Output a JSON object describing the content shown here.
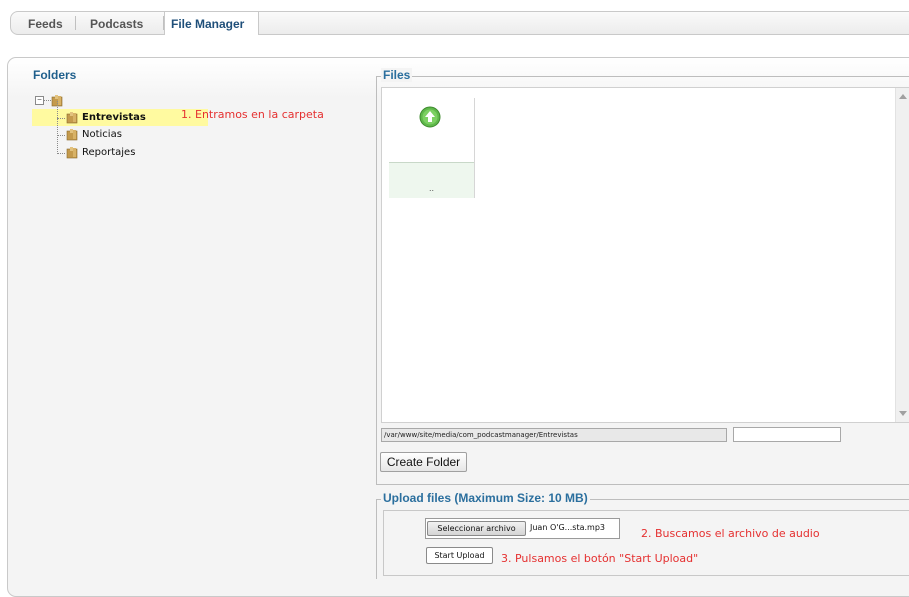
{
  "tabs": [
    {
      "label": "Feeds",
      "active": false
    },
    {
      "label": "Podcasts",
      "active": false
    },
    {
      "label": "File Manager",
      "active": true
    }
  ],
  "folders": {
    "title": "Folders",
    "items": [
      {
        "label": "Entrevistas",
        "selected": true
      },
      {
        "label": "Noticias",
        "selected": false
      },
      {
        "label": "Reportajes",
        "selected": false
      }
    ],
    "annotation": "1. Entramos en la carpeta"
  },
  "files": {
    "legend": "Files",
    "parent_item_label": "..",
    "path": "/var/www/site/media/com_podcastmanager/Entrevistas",
    "new_folder_name": "",
    "create_folder_label": "Create Folder"
  },
  "upload": {
    "legend": "Upload files (Maximum Size: 10 MB)",
    "choose_label": "Seleccionar archivo",
    "chosen_file": "Juan O'G...sta.mp3",
    "annotation_choose": "2. Buscamos el archivo de audio",
    "start_label": "Start Upload",
    "annotation_start": "3. Pulsamos el botón \"Start Upload\""
  },
  "colors": {
    "accent_title": "#1f5f8c",
    "legend": "#2b6f9e",
    "annotation": "#e53030",
    "selected_highlight": "#fffaa0"
  },
  "icons": {
    "folder": "folder-icon",
    "up": "up-arrow-icon"
  }
}
